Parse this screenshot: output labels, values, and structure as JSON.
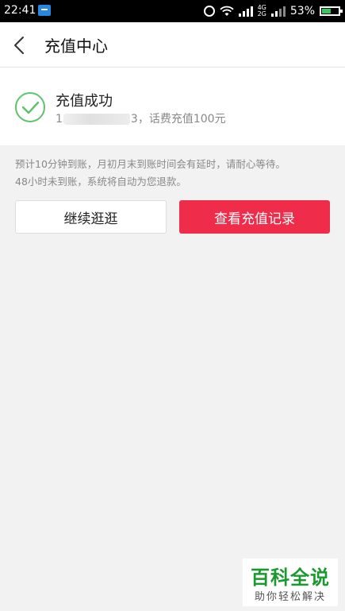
{
  "status_bar": {
    "time": "22:41",
    "network_top": "4G",
    "network_bottom": "2G",
    "battery_percent": "53%",
    "battery_level": 0.53,
    "icons": [
      "message-icon",
      "alarm-icon",
      "wifi-icon",
      "signal-icon",
      "battery-icon"
    ]
  },
  "header": {
    "title": "充值中心",
    "back_icon": "chevron-left-icon"
  },
  "result": {
    "title": "充值成功",
    "phone_prefix": "1",
    "phone_suffix": "3",
    "detail": "，话费充值100元",
    "icon": "check-circle-icon",
    "accent_color": "#5cc36b"
  },
  "notice": {
    "line1": "预计10分钟到账，月初月末到账时间会有延时，请耐心等待。",
    "line2": "48小时未到账，系统将自动为您退款。"
  },
  "actions": {
    "continue_label": "继续逛逛",
    "records_label": "查看充值记录",
    "primary_color": "#ef2c4a"
  },
  "watermark": {
    "title": "百科全说",
    "subtitle": "助你轻松解决"
  }
}
